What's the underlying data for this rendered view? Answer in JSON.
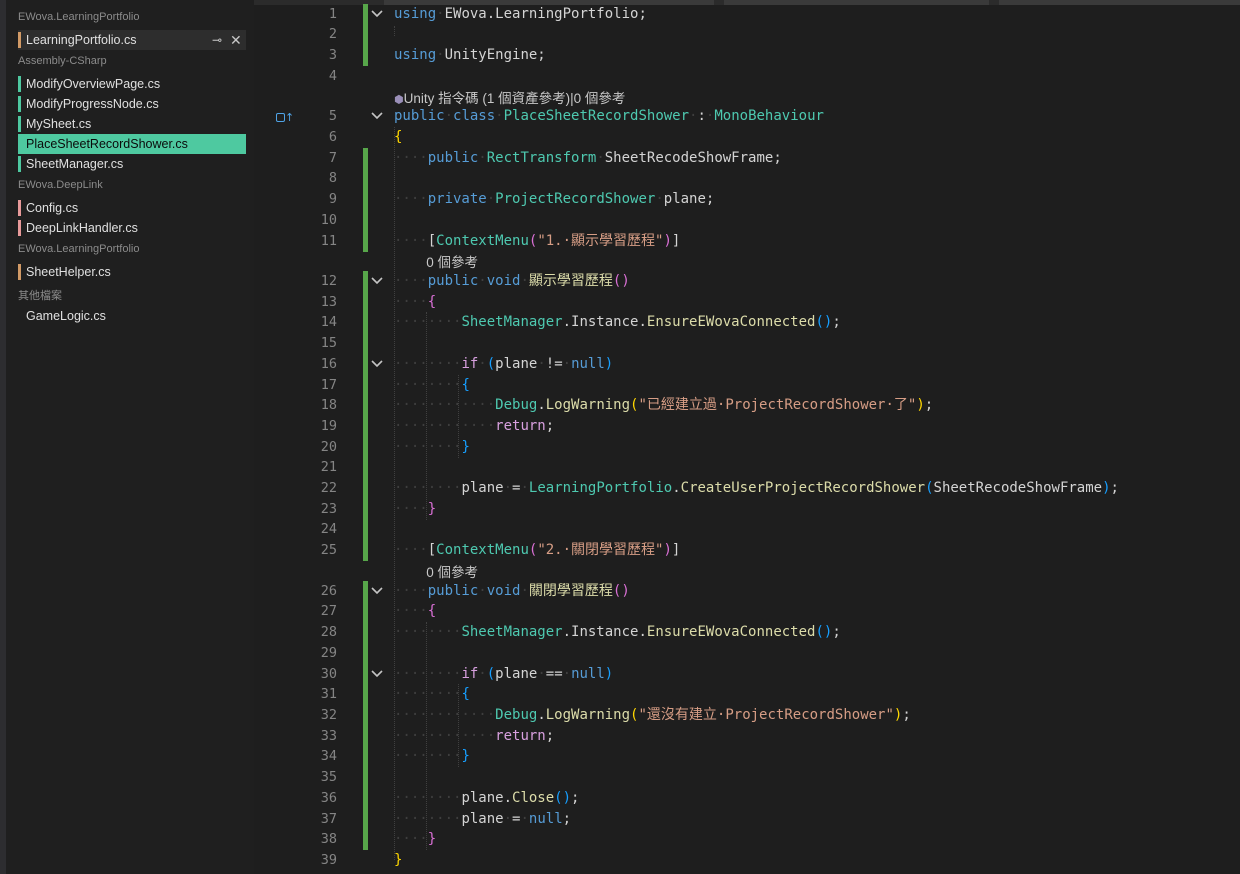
{
  "sidebar": {
    "groups": [
      {
        "header": "EWova.LearningPortfolio",
        "files": [
          {
            "name": "LearningPortfolio.cs",
            "color": "#d19a66",
            "tab_active": true
          }
        ]
      },
      {
        "header": "Assembly-CSharp",
        "files": [
          {
            "name": "ModifyOverviewPage.cs",
            "color": "#4ec9a0"
          },
          {
            "name": "ModifyProgressNode.cs",
            "color": "#4ec9a0"
          },
          {
            "name": "MySheet.cs",
            "color": "#4ec9a0"
          },
          {
            "name": "PlaceSheetRecordShower.cs",
            "color": "#4ec9a0",
            "selected": true
          },
          {
            "name": "SheetManager.cs",
            "color": "#4ec9a0"
          }
        ]
      },
      {
        "header": "EWova.DeepLink",
        "files": [
          {
            "name": "Config.cs",
            "color": "#e89a9a"
          },
          {
            "name": "DeepLinkHandler.cs",
            "color": "#e89a9a"
          }
        ]
      },
      {
        "header": "EWova.LearningPortfolio",
        "files": [
          {
            "name": "SheetHelper.cs",
            "color": "#d19a66"
          }
        ]
      },
      {
        "header": "其他檔案",
        "files": [
          {
            "name": "GameLogic.cs",
            "color": ""
          }
        ]
      }
    ]
  },
  "editor": {
    "codelens": {
      "class": "Unity 指令碼 (1 個資產參考)|0 個參考",
      "method": "0 個參考"
    },
    "lines": [
      {
        "n": "1",
        "fold": true,
        "tokens": [
          [
            "kw",
            "using"
          ],
          [
            "ws",
            "·"
          ],
          [
            "tx",
            "EWova.LearningPortfolio;"
          ]
        ]
      },
      {
        "n": "2",
        "tokens": []
      },
      {
        "n": "3",
        "tokens": [
          [
            "kw",
            "using"
          ],
          [
            "ws",
            "·"
          ],
          [
            "tx",
            "UnityEngine;"
          ]
        ]
      },
      {
        "n": "4",
        "tokens": []
      },
      {
        "n": "5",
        "fold": true,
        "gutterIcon": true,
        "tokens": [
          [
            "kw",
            "public"
          ],
          [
            "ws",
            "·"
          ],
          [
            "kw",
            "class"
          ],
          [
            "ws",
            "·"
          ],
          [
            "ty",
            "PlaceSheetRecordShower"
          ],
          [
            "ws",
            "·"
          ],
          [
            "tx",
            ":"
          ],
          [
            "ws",
            "·"
          ],
          [
            "ty",
            "MonoBehaviour"
          ]
        ]
      },
      {
        "n": "6",
        "tokens": [
          [
            "br",
            "{"
          ]
        ]
      },
      {
        "n": "7",
        "tokens": [
          [
            "ws",
            "····"
          ],
          [
            "kw",
            "public"
          ],
          [
            "ws",
            "·"
          ],
          [
            "ty",
            "RectTransform"
          ],
          [
            "ws",
            "·"
          ],
          [
            "tx",
            "SheetRecodeShowFrame;"
          ]
        ]
      },
      {
        "n": "8",
        "tokens": []
      },
      {
        "n": "9",
        "tokens": [
          [
            "ws",
            "····"
          ],
          [
            "kw",
            "private"
          ],
          [
            "ws",
            "·"
          ],
          [
            "ty",
            "ProjectRecordShower"
          ],
          [
            "ws",
            "·"
          ],
          [
            "tx",
            "plane;"
          ]
        ]
      },
      {
        "n": "10",
        "tokens": []
      },
      {
        "n": "11",
        "tokens": [
          [
            "ws",
            "····"
          ],
          [
            "tx",
            "["
          ],
          [
            "ty",
            "ContextMenu"
          ],
          [
            "bp",
            "("
          ],
          [
            "st",
            "\"1.·顯示學習歷程\""
          ],
          [
            "bp",
            ")"
          ],
          [
            "tx",
            "]"
          ]
        ]
      },
      {
        "n": "12",
        "fold": true,
        "tokens": [
          [
            "ws",
            "····"
          ],
          [
            "kw",
            "public"
          ],
          [
            "ws",
            "·"
          ],
          [
            "kw",
            "void"
          ],
          [
            "ws",
            "·"
          ],
          [
            "mt",
            "顯示學習歷程"
          ],
          [
            "bp",
            "()"
          ]
        ]
      },
      {
        "n": "13",
        "tokens": [
          [
            "ws",
            "····"
          ],
          [
            "bp",
            "{"
          ]
        ]
      },
      {
        "n": "14",
        "tokens": [
          [
            "ws",
            "········"
          ],
          [
            "ty",
            "SheetManager"
          ],
          [
            "tx",
            ".Instance."
          ],
          [
            "mt",
            "EnsureEWovaConnected"
          ],
          [
            "bb",
            "()"
          ],
          [
            "tx",
            ";"
          ]
        ]
      },
      {
        "n": "15",
        "tokens": []
      },
      {
        "n": "16",
        "fold": true,
        "tokens": [
          [
            "ws",
            "········"
          ],
          [
            "ctl",
            "if"
          ],
          [
            "ws",
            "·"
          ],
          [
            "bb",
            "("
          ],
          [
            "tx",
            "plane"
          ],
          [
            "ws",
            "·"
          ],
          [
            "tx",
            "!="
          ],
          [
            "ws",
            "·"
          ],
          [
            "kw",
            "null"
          ],
          [
            "bb",
            ")"
          ]
        ]
      },
      {
        "n": "17",
        "tokens": [
          [
            "ws",
            "········"
          ],
          [
            "bb",
            "{"
          ]
        ]
      },
      {
        "n": "18",
        "tokens": [
          [
            "ws",
            "············"
          ],
          [
            "ty",
            "Debug"
          ],
          [
            "tx",
            "."
          ],
          [
            "mt",
            "LogWarning"
          ],
          [
            "br",
            "("
          ],
          [
            "st",
            "\"已經建立過·ProjectRecordShower·了\""
          ],
          [
            "br",
            ")"
          ],
          [
            "tx",
            ";"
          ]
        ]
      },
      {
        "n": "19",
        "tokens": [
          [
            "ws",
            "············"
          ],
          [
            "ctl",
            "return"
          ],
          [
            "tx",
            ";"
          ]
        ]
      },
      {
        "n": "20",
        "tokens": [
          [
            "ws",
            "········"
          ],
          [
            "bb",
            "}"
          ]
        ]
      },
      {
        "n": "21",
        "tokens": []
      },
      {
        "n": "22",
        "tokens": [
          [
            "ws",
            "········"
          ],
          [
            "tx",
            "plane"
          ],
          [
            "ws",
            "·"
          ],
          [
            "tx",
            "="
          ],
          [
            "ws",
            "·"
          ],
          [
            "ty",
            "LearningPortfolio"
          ],
          [
            "tx",
            "."
          ],
          [
            "mt",
            "CreateUserProjectRecordShower"
          ],
          [
            "bb",
            "("
          ],
          [
            "tx",
            "SheetRecodeShowFrame"
          ],
          [
            "bb",
            ")"
          ],
          [
            "tx",
            ";"
          ]
        ]
      },
      {
        "n": "23",
        "tokens": [
          [
            "ws",
            "····"
          ],
          [
            "bp",
            "}"
          ]
        ]
      },
      {
        "n": "24",
        "tokens": []
      },
      {
        "n": "25",
        "tokens": [
          [
            "ws",
            "····"
          ],
          [
            "tx",
            "["
          ],
          [
            "ty",
            "ContextMenu"
          ],
          [
            "bp",
            "("
          ],
          [
            "st",
            "\"2.·關閉學習歷程\""
          ],
          [
            "bp",
            ")"
          ],
          [
            "tx",
            "]"
          ]
        ]
      },
      {
        "n": "26",
        "fold": true,
        "tokens": [
          [
            "ws",
            "····"
          ],
          [
            "kw",
            "public"
          ],
          [
            "ws",
            "·"
          ],
          [
            "kw",
            "void"
          ],
          [
            "ws",
            "·"
          ],
          [
            "mt",
            "關閉學習歷程"
          ],
          [
            "bp",
            "()"
          ]
        ]
      },
      {
        "n": "27",
        "tokens": [
          [
            "ws",
            "····"
          ],
          [
            "bp",
            "{"
          ]
        ]
      },
      {
        "n": "28",
        "tokens": [
          [
            "ws",
            "········"
          ],
          [
            "ty",
            "SheetManager"
          ],
          [
            "tx",
            ".Instance."
          ],
          [
            "mt",
            "EnsureEWovaConnected"
          ],
          [
            "bb",
            "()"
          ],
          [
            "tx",
            ";"
          ]
        ]
      },
      {
        "n": "29",
        "tokens": []
      },
      {
        "n": "30",
        "fold": true,
        "tokens": [
          [
            "ws",
            "········"
          ],
          [
            "ctl",
            "if"
          ],
          [
            "ws",
            "·"
          ],
          [
            "bb",
            "("
          ],
          [
            "tx",
            "plane"
          ],
          [
            "ws",
            "·"
          ],
          [
            "tx",
            "=="
          ],
          [
            "ws",
            "·"
          ],
          [
            "kw",
            "null"
          ],
          [
            "bb",
            ")"
          ]
        ]
      },
      {
        "n": "31",
        "tokens": [
          [
            "ws",
            "········"
          ],
          [
            "bb",
            "{"
          ]
        ]
      },
      {
        "n": "32",
        "tokens": [
          [
            "ws",
            "············"
          ],
          [
            "ty",
            "Debug"
          ],
          [
            "tx",
            "."
          ],
          [
            "mt",
            "LogWarning"
          ],
          [
            "br",
            "("
          ],
          [
            "st",
            "\"還沒有建立·ProjectRecordShower\""
          ],
          [
            "br",
            ")"
          ],
          [
            "tx",
            ";"
          ]
        ]
      },
      {
        "n": "33",
        "tokens": [
          [
            "ws",
            "············"
          ],
          [
            "ctl",
            "return"
          ],
          [
            "tx",
            ";"
          ]
        ]
      },
      {
        "n": "34",
        "tokens": [
          [
            "ws",
            "········"
          ],
          [
            "bb",
            "}"
          ]
        ]
      },
      {
        "n": "35",
        "tokens": []
      },
      {
        "n": "36",
        "tokens": [
          [
            "ws",
            "········"
          ],
          [
            "tx",
            "plane."
          ],
          [
            "mt",
            "Close"
          ],
          [
            "bb",
            "()"
          ],
          [
            "tx",
            ";"
          ]
        ]
      },
      {
        "n": "37",
        "tokens": [
          [
            "ws",
            "········"
          ],
          [
            "tx",
            "plane"
          ],
          [
            "ws",
            "·"
          ],
          [
            "tx",
            "="
          ],
          [
            "ws",
            "·"
          ],
          [
            "kw",
            "null"
          ],
          [
            "tx",
            ";"
          ]
        ]
      },
      {
        "n": "38",
        "tokens": [
          [
            "ws",
            "····"
          ],
          [
            "bp",
            "}"
          ]
        ]
      },
      {
        "n": "39",
        "tokens": [
          [
            "br",
            "}"
          ]
        ]
      }
    ]
  }
}
